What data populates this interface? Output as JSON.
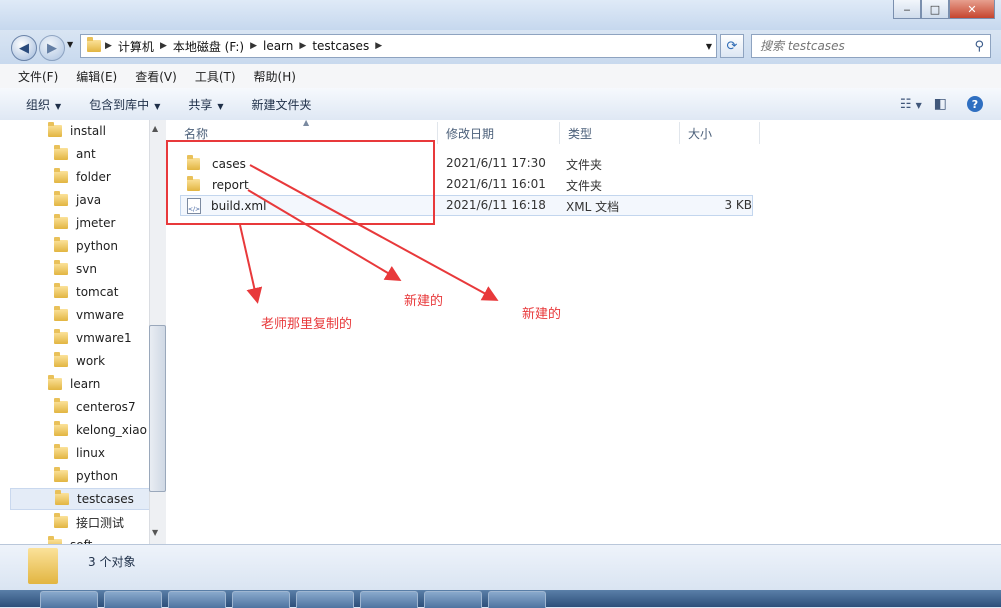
{
  "address": {
    "crumbs": [
      "计算机",
      "本地磁盘 (F:)",
      "learn",
      "testcases"
    ]
  },
  "search": {
    "placeholder": "搜索 testcases"
  },
  "menubar": [
    "文件(F)",
    "编辑(E)",
    "查看(V)",
    "工具(T)",
    "帮助(H)"
  ],
  "toolbar": {
    "organize": "组织",
    "include": "包含到库中",
    "share": "共享",
    "new_folder": "新建文件夹"
  },
  "tree": [
    {
      "label": "install",
      "level": 0
    },
    {
      "label": "ant",
      "level": 1
    },
    {
      "label": "folder",
      "level": 1
    },
    {
      "label": "java",
      "level": 1
    },
    {
      "label": "jmeter",
      "level": 1
    },
    {
      "label": "python",
      "level": 1
    },
    {
      "label": "svn",
      "level": 1
    },
    {
      "label": "tomcat",
      "level": 1
    },
    {
      "label": "vmware",
      "level": 1
    },
    {
      "label": "vmware1",
      "level": 1
    },
    {
      "label": "work",
      "level": 1
    },
    {
      "label": "learn",
      "level": 0
    },
    {
      "label": "centeros7",
      "level": 1
    },
    {
      "label": "kelong_xiao",
      "level": 1
    },
    {
      "label": "linux",
      "level": 1
    },
    {
      "label": "python",
      "level": 1
    },
    {
      "label": "testcases",
      "level": 1,
      "selected": true
    },
    {
      "label": "接口测试",
      "level": 1
    },
    {
      "label": "soft",
      "level": 0
    }
  ],
  "columns": {
    "name": "名称",
    "date": "修改日期",
    "type": "类型",
    "size": "大小"
  },
  "files": [
    {
      "name": "cases",
      "date": "2021/6/11 17:30",
      "type": "文件夹",
      "size": "",
      "icon": "folder-icon"
    },
    {
      "name": "report",
      "date": "2021/6/11 16:01",
      "type": "文件夹",
      "size": "",
      "icon": "folder-icon"
    },
    {
      "name": "build.xml",
      "date": "2021/6/11 16:18",
      "type": "XML 文档",
      "size": "3 KB",
      "icon": "xml-file-icon"
    }
  ],
  "annotations": {
    "copied": "老师那里复制的",
    "new1": "新建的",
    "new2": "新建的",
    "color": "#e8393b"
  },
  "status": {
    "count": "3 个对象"
  }
}
